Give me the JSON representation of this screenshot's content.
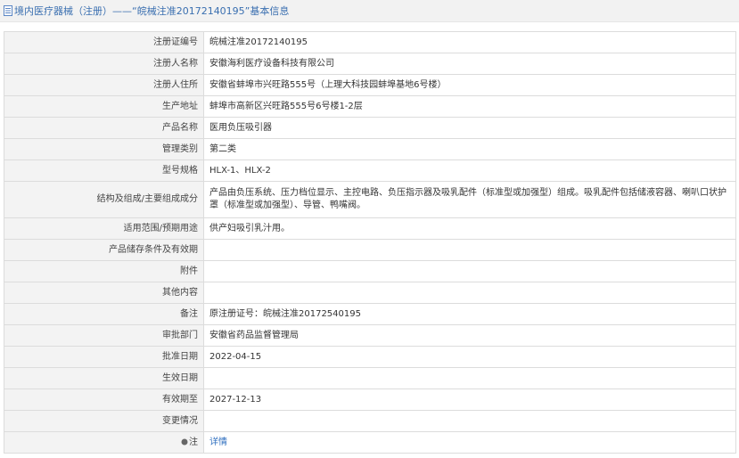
{
  "header": {
    "title": "境内医疗器械（注册）——“皖械注准20172140195”基本信息"
  },
  "fields": [
    {
      "label": "注册证编号",
      "value": "皖械注准20172140195"
    },
    {
      "label": "注册人名称",
      "value": "安徽海利医疗设备科技有限公司"
    },
    {
      "label": "注册人住所",
      "value": "安徽省蚌埠市兴旺路555号（上理大科技园蚌埠基地6号楼）"
    },
    {
      "label": "生产地址",
      "value": "蚌埠市高新区兴旺路555号6号楼1-2层"
    },
    {
      "label": "产品名称",
      "value": "医用负压吸引器"
    },
    {
      "label": "管理类别",
      "value": "第二类"
    },
    {
      "label": "型号规格",
      "value": "HLX-1、HLX-2"
    },
    {
      "label": "结构及组成/主要组成成分",
      "value": "产品由负压系统、压力档位显示、主控电路、负压指示器及吸乳配件（标准型或加强型）组成。吸乳配件包括储液容器、喇叭口状护罩（标准型或加强型）、导管、鸭嘴阀。"
    },
    {
      "label": "适用范围/预期用途",
      "value": "供产妇吸引乳汁用。"
    },
    {
      "label": "产品储存条件及有效期",
      "value": ""
    },
    {
      "label": "附件",
      "value": ""
    },
    {
      "label": "其他内容",
      "value": ""
    },
    {
      "label": "备注",
      "value": "原注册证号：皖械注准20172540195"
    },
    {
      "label": "审批部门",
      "value": "安徽省药品监督管理局"
    },
    {
      "label": "批准日期",
      "value": "2022-04-15"
    },
    {
      "label": "生效日期",
      "value": ""
    },
    {
      "label": "有效期至",
      "value": "2027-12-13"
    },
    {
      "label": "变更情况",
      "value": ""
    }
  ],
  "note": {
    "label": "注",
    "link_text": "详情",
    "icon": "note-icon"
  },
  "colors": {
    "title": "#3a6fb0",
    "link": "#2f6fbf",
    "label_bg": "#f3f3f3",
    "border": "#dcdcdc"
  }
}
